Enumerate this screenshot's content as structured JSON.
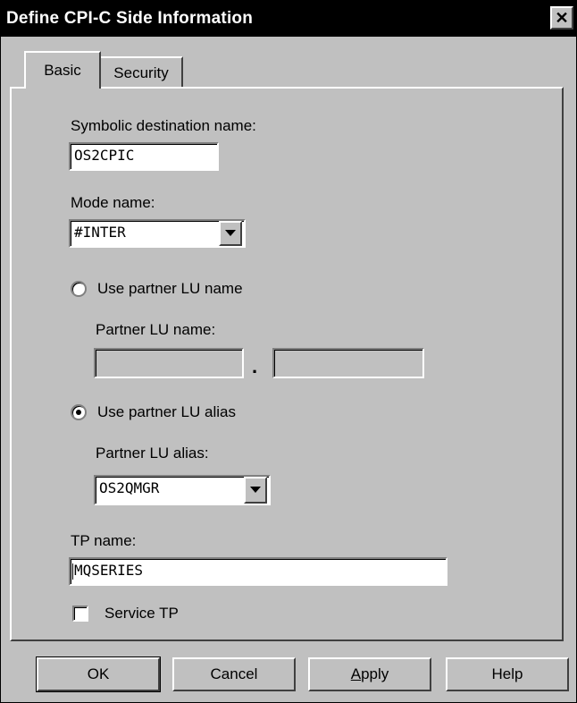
{
  "window": {
    "title": "Define CPI-C Side Information",
    "close_label": "✕"
  },
  "tabs": [
    {
      "label": "Basic"
    },
    {
      "label": "Security"
    }
  ],
  "basic": {
    "symbolic_destination_label": "Symbolic destination name:",
    "symbolic_destination_value": "OS2CPIC",
    "mode_label": "Mode name:",
    "mode_value": "#INTER",
    "use_partner_lu_name_label": "Use partner LU name",
    "partner_lu_name_label": "Partner LU name:",
    "partner_lu_name_part1": "",
    "partner_lu_name_separator": ".",
    "partner_lu_name_part2": "",
    "use_partner_lu_alias_label": "Use partner LU alias",
    "partner_lu_alias_label": "Partner LU alias:",
    "partner_lu_alias_value": "OS2QMGR",
    "tp_name_label": "TP name:",
    "tp_name_value": "MQSERIES",
    "service_tp_label": "Service TP",
    "use_partner_lu_name_selected": false,
    "use_partner_lu_alias_selected": true,
    "service_tp_checked": false
  },
  "buttons": {
    "ok": "OK",
    "cancel": "Cancel",
    "apply": "Apply",
    "help": "Help"
  }
}
